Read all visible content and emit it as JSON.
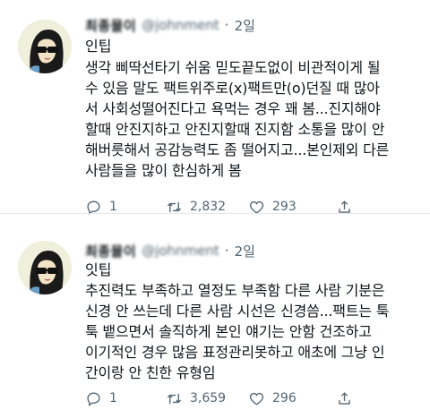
{
  "tweets": [
    {
      "name": "최종몰이",
      "handle": "@johnment",
      "separator": "·",
      "time": "2일",
      "tip_title": "인팁",
      "body": "생각 삐딱선타기 쉬움 믿도끝도없이 비관적이게 될\n수 있음 말도 팩트위주로(x)팩트만(o)던질 때 많아\n서 사회성떨어진다고 욕먹는 경우 꽤 봄...진지해야\n할때 안진지하고 안진지할때 진지함 소통을 많이 안\n해버릇해서 공감능력도 좀 떨어지고...본인제외 다른\n사람들을 많이 한심하게 봄",
      "replies": "1",
      "retweets": "2,832",
      "likes": "293"
    },
    {
      "name": "최종몰이",
      "handle": "@johnment",
      "separator": "·",
      "time": "2일",
      "tip_title": "잇팁",
      "body": "추진력도 부족하고 열정도 부족함 다른 사람 기분은\n신경 안 쓰는데 다른 사람 시선은 신경씀...팩트는 툭\n툭 뱉으면서 솔직하게 본인 얘기는 안함 건조하고\n이기적인 경우 많음 표정관리못하고 애초에 그냥 인\n간이랑 안 친한 유형임",
      "replies": "1",
      "retweets": "3,659",
      "likes": "296"
    }
  ],
  "icons": {
    "reply": "reply-icon",
    "retweet": "retweet-icon",
    "like": "heart-icon",
    "share": "share-icon"
  }
}
